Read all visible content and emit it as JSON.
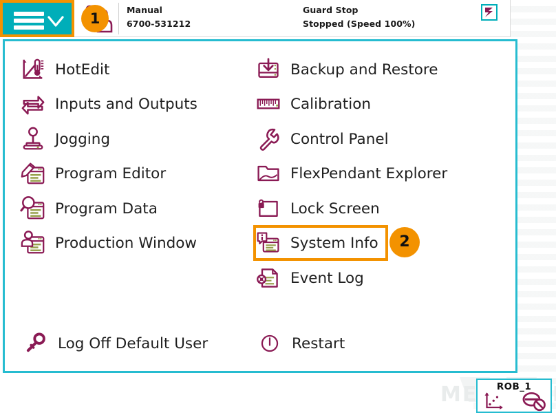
{
  "header": {
    "hamburger_icon": "hamburger-menu-icon",
    "chevron_icon": "chevron-down-icon",
    "operator_icon": "operator-robot-icon",
    "mode_label": "Manual",
    "controller_id": "6700-531212",
    "state_label": "Guard Stop",
    "state_detail": "Stopped (Speed 100%)",
    "status_icon": "motors-off-icon",
    "badge_1": "1"
  },
  "menu": {
    "left_column": [
      {
        "label": "HotEdit",
        "icon": "hotedit-icon"
      },
      {
        "label": "Inputs and Outputs",
        "icon": "inputs-outputs-icon"
      },
      {
        "label": "Jogging",
        "icon": "joystick-icon"
      },
      {
        "label": "Program Editor",
        "icon": "program-editor-icon"
      },
      {
        "label": "Program Data",
        "icon": "program-data-icon"
      },
      {
        "label": "Production Window",
        "icon": "production-window-icon"
      }
    ],
    "right_column": [
      {
        "label": "Backup and Restore",
        "icon": "backup-restore-icon"
      },
      {
        "label": "Calibration",
        "icon": "calibration-ruler-icon"
      },
      {
        "label": "Control Panel",
        "icon": "wrench-icon"
      },
      {
        "label": "FlexPendant Explorer",
        "icon": "folder-icon"
      },
      {
        "label": "Lock Screen",
        "icon": "lock-screen-icon"
      },
      {
        "label": "System Info",
        "icon": "system-info-icon"
      },
      {
        "label": "Event Log",
        "icon": "event-log-icon"
      }
    ],
    "bottom_left": {
      "label": "Log Off Default User",
      "icon": "key-icon"
    },
    "bottom_right": {
      "label": "Restart",
      "icon": "power-restart-icon"
    },
    "badge_2": "2"
  },
  "taskbar": {
    "robot_name": "ROB_1",
    "jog_icon": "jog-axes-icon",
    "motors_icon": "motors-disabled-icon"
  },
  "watermark": {
    "text": "MECH MIND"
  },
  "colors": {
    "teal": "#00aeb9",
    "panel_border": "#26bcd0",
    "highlight_orange": "#f39200",
    "icon_purple": "#8a1a54",
    "icon_olive": "#97a04b",
    "text": "#1f1f1f"
  }
}
